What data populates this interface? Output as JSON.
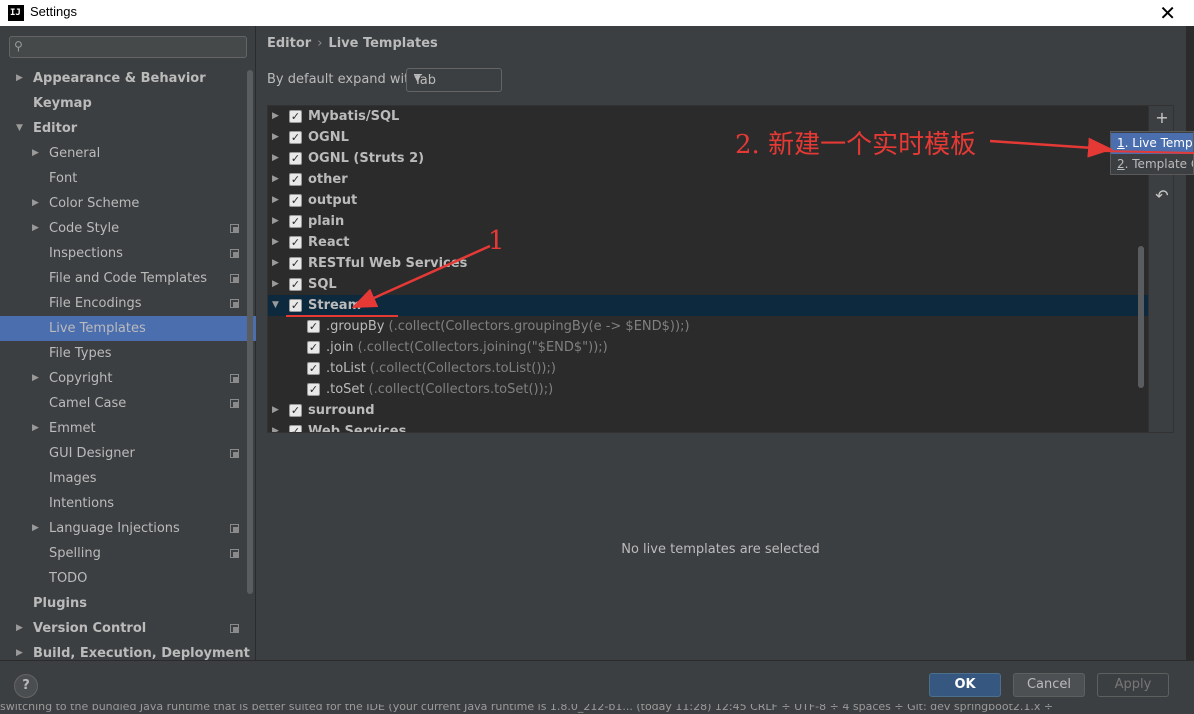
{
  "window": {
    "title": "Settings",
    "app_icon_text": "IJ",
    "close_glyph": "✕"
  },
  "sidebar": {
    "search_placeholder": "",
    "items": [
      {
        "label": "Appearance & Behavior",
        "level": 0,
        "arrow": "right",
        "bold": true,
        "copy": false,
        "selected": false
      },
      {
        "label": "Keymap",
        "level": 0,
        "arrow": "none",
        "bold": true,
        "copy": false,
        "selected": false
      },
      {
        "label": "Editor",
        "level": 0,
        "arrow": "down",
        "bold": true,
        "copy": false,
        "selected": false
      },
      {
        "label": "General",
        "level": 1,
        "arrow": "right",
        "bold": false,
        "copy": false,
        "selected": false
      },
      {
        "label": "Font",
        "level": 1,
        "arrow": "none",
        "bold": false,
        "copy": false,
        "selected": false
      },
      {
        "label": "Color Scheme",
        "level": 1,
        "arrow": "right",
        "bold": false,
        "copy": false,
        "selected": false
      },
      {
        "label": "Code Style",
        "level": 1,
        "arrow": "right",
        "bold": false,
        "copy": true,
        "selected": false
      },
      {
        "label": "Inspections",
        "level": 1,
        "arrow": "none",
        "bold": false,
        "copy": true,
        "selected": false
      },
      {
        "label": "File and Code Templates",
        "level": 1,
        "arrow": "none",
        "bold": false,
        "copy": true,
        "selected": false
      },
      {
        "label": "File Encodings",
        "level": 1,
        "arrow": "none",
        "bold": false,
        "copy": true,
        "selected": false
      },
      {
        "label": "Live Templates",
        "level": 1,
        "arrow": "none",
        "bold": false,
        "copy": false,
        "selected": true
      },
      {
        "label": "File Types",
        "level": 1,
        "arrow": "none",
        "bold": false,
        "copy": false,
        "selected": false
      },
      {
        "label": "Copyright",
        "level": 1,
        "arrow": "right",
        "bold": false,
        "copy": true,
        "selected": false
      },
      {
        "label": "Camel Case",
        "level": 1,
        "arrow": "none",
        "bold": false,
        "copy": true,
        "selected": false
      },
      {
        "label": "Emmet",
        "level": 1,
        "arrow": "right",
        "bold": false,
        "copy": false,
        "selected": false
      },
      {
        "label": "GUI Designer",
        "level": 1,
        "arrow": "none",
        "bold": false,
        "copy": true,
        "selected": false
      },
      {
        "label": "Images",
        "level": 1,
        "arrow": "none",
        "bold": false,
        "copy": false,
        "selected": false
      },
      {
        "label": "Intentions",
        "level": 1,
        "arrow": "none",
        "bold": false,
        "copy": false,
        "selected": false
      },
      {
        "label": "Language Injections",
        "level": 1,
        "arrow": "right",
        "bold": false,
        "copy": true,
        "selected": false
      },
      {
        "label": "Spelling",
        "level": 1,
        "arrow": "none",
        "bold": false,
        "copy": true,
        "selected": false
      },
      {
        "label": "TODO",
        "level": 1,
        "arrow": "none",
        "bold": false,
        "copy": false,
        "selected": false
      },
      {
        "label": "Plugins",
        "level": 0,
        "arrow": "none",
        "bold": true,
        "copy": false,
        "selected": false
      },
      {
        "label": "Version Control",
        "level": 0,
        "arrow": "right",
        "bold": true,
        "copy": true,
        "selected": false
      },
      {
        "label": "Build, Execution, Deployment",
        "level": 0,
        "arrow": "right",
        "bold": true,
        "copy": false,
        "selected": false
      }
    ]
  },
  "main": {
    "breadcrumb": {
      "parent": "Editor",
      "separator": "›",
      "current": "Live Templates"
    },
    "expand_label": "By default expand with",
    "expand_value": "Tab",
    "groups": [
      {
        "name": "Mybatis/SQL",
        "checked": true,
        "expanded": false,
        "selected": false
      },
      {
        "name": "OGNL",
        "checked": true,
        "expanded": false,
        "selected": false
      },
      {
        "name": "OGNL (Struts 2)",
        "checked": true,
        "expanded": false,
        "selected": false
      },
      {
        "name": "other",
        "checked": true,
        "expanded": false,
        "selected": false
      },
      {
        "name": "output",
        "checked": true,
        "expanded": false,
        "selected": false
      },
      {
        "name": "plain",
        "checked": true,
        "expanded": false,
        "selected": false
      },
      {
        "name": "React",
        "checked": true,
        "expanded": false,
        "selected": false
      },
      {
        "name": "RESTful Web Services",
        "checked": true,
        "expanded": false,
        "selected": false
      },
      {
        "name": "SQL",
        "checked": true,
        "expanded": false,
        "selected": false
      },
      {
        "name": "Stream",
        "checked": true,
        "expanded": true,
        "selected": true,
        "templates": [
          {
            "abbr": ".groupBy",
            "desc": "(.collect(Collectors.groupingBy(e -> $END$));)",
            "checked": true
          },
          {
            "abbr": ".join",
            "desc": "(.collect(Collectors.joining(\"$END$\"));)",
            "checked": true
          },
          {
            "abbr": ".toList",
            "desc": "(.collect(Collectors.toList());)",
            "checked": true
          },
          {
            "abbr": ".toSet",
            "desc": "(.collect(Collectors.toSet());)",
            "checked": true
          }
        ]
      },
      {
        "name": "surround",
        "checked": true,
        "expanded": false,
        "selected": false
      },
      {
        "name": "Web Services",
        "checked": true,
        "expanded": false,
        "selected": false
      }
    ],
    "toolbar": {
      "add": "+",
      "undo": "↶"
    },
    "empty_message": "No live templates are selected"
  },
  "popup": {
    "items": [
      {
        "num": "1",
        "label": ". Live Templ",
        "active": true
      },
      {
        "num": "2",
        "label": ". Template G",
        "active": false
      }
    ]
  },
  "annotations": {
    "step1": "1",
    "step2": "2. 新建一个实时模板"
  },
  "footer": {
    "help": "?",
    "ok": "OK",
    "cancel": "Cancel",
    "apply": "Apply"
  },
  "statusbar": {
    "text": "switching to the bundled Java runtime that is better suited for the IDE (your current Java runtime is 1.8.0_212-b1... (today 11:28)        12:45   CRLF ÷   UTF-8 ÷   4 spaces ÷   Git: dev springboot2.1.x ÷"
  },
  "colors": {
    "accent": "#4b6eaf",
    "selected_row": "#0d293e",
    "annotation": "#e53935",
    "ok_button": "#365880"
  },
  "icons": {
    "search": "search-icon",
    "checkbox": "checkmark-icon",
    "arrow_right": "chevron-right-icon",
    "arrow_down": "chevron-down-icon"
  }
}
